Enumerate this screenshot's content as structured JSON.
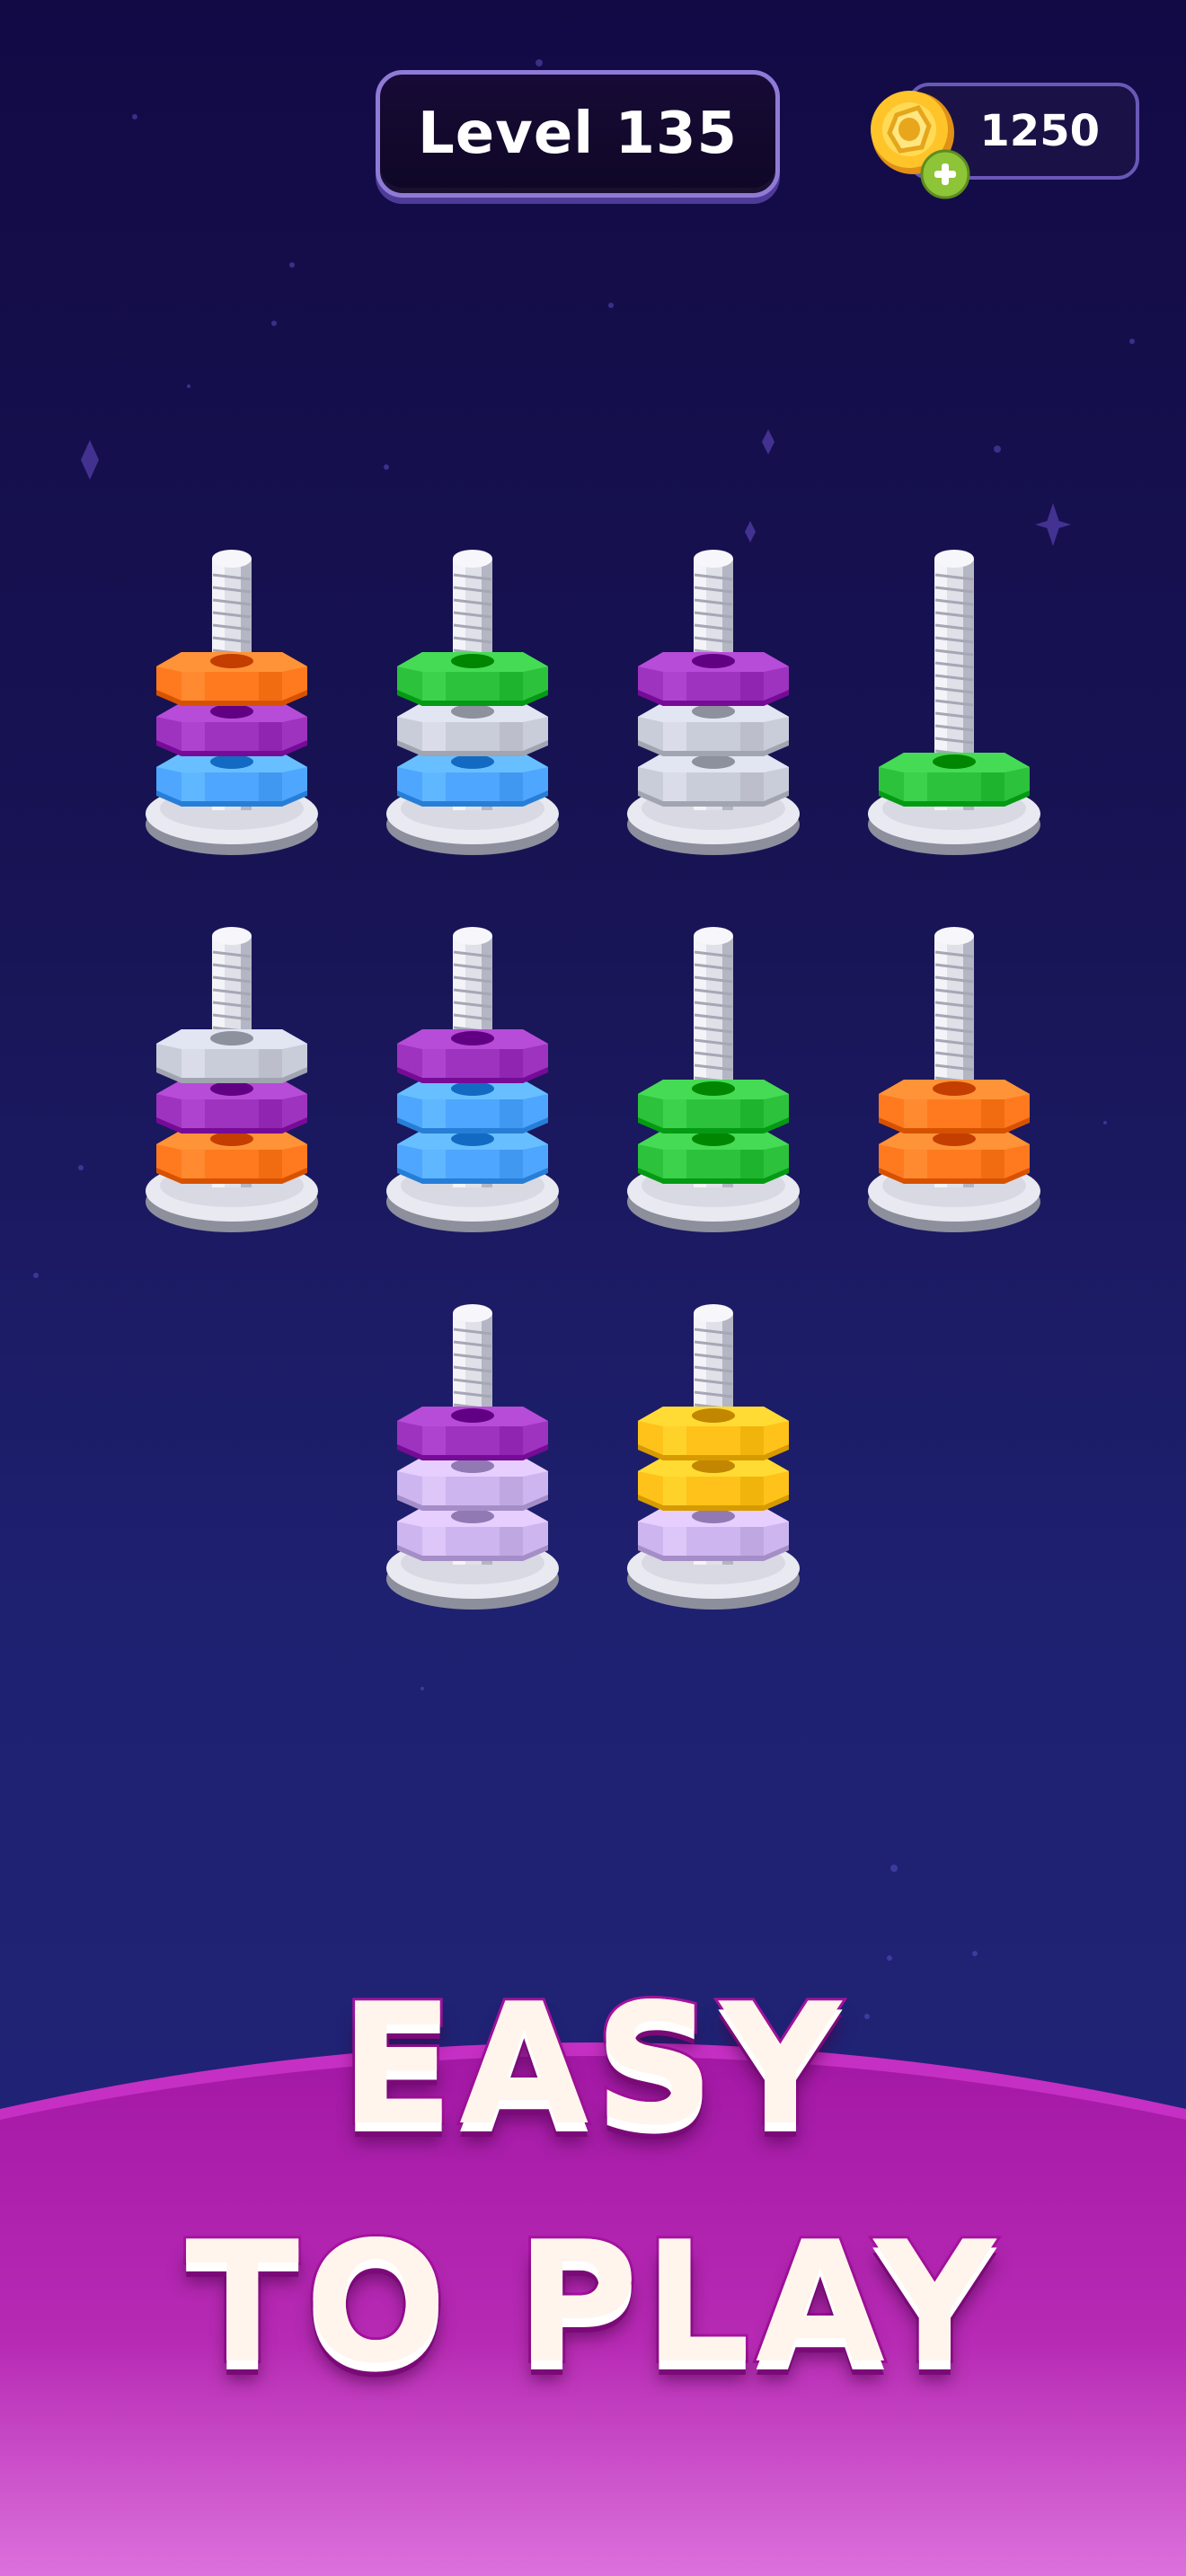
{
  "header": {
    "level_label": "Level 135",
    "coins": "1250"
  },
  "colors": {
    "background_top": "#120a45",
    "background_bottom": "#22247a",
    "promo_magenta": "#a5129e",
    "promo_light": "#e06be0"
  },
  "nut_colors": {
    "orange": "#ff7a1f",
    "purple": "#9e33bf",
    "blue": "#4fa6ff",
    "green": "#2dc23c",
    "silver": "#c9ccd9",
    "lavender": "#cdb6ef",
    "yellow": "#ffc21a"
  },
  "board": {
    "poles": [
      {
        "nuts_bottom_to_top": [
          "blue",
          "purple",
          "orange"
        ]
      },
      {
        "nuts_bottom_to_top": [
          "blue",
          "silver",
          "green"
        ]
      },
      {
        "nuts_bottom_to_top": [
          "silver",
          "silver",
          "purple"
        ]
      },
      {
        "nuts_bottom_to_top": [
          "green"
        ]
      },
      {
        "nuts_bottom_to_top": [
          "orange",
          "purple",
          "silver"
        ]
      },
      {
        "nuts_bottom_to_top": [
          "blue",
          "blue",
          "purple"
        ]
      },
      {
        "nuts_bottom_to_top": [
          "green",
          "green"
        ]
      },
      {
        "nuts_bottom_to_top": [
          "orange",
          "orange"
        ]
      },
      {
        "nuts_bottom_to_top": [
          "lavender",
          "lavender",
          "purple"
        ]
      },
      {
        "nuts_bottom_to_top": [
          "lavender",
          "yellow",
          "yellow"
        ]
      }
    ]
  },
  "promo": {
    "line1": "EASY",
    "line2": "TO PLAY"
  },
  "icons": {
    "coin": "coin-icon",
    "add": "plus-icon"
  }
}
